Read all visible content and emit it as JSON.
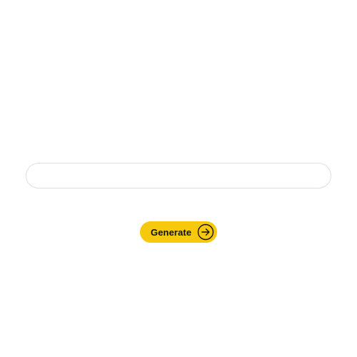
{
  "prompt": {
    "value": "",
    "placeholder": ""
  },
  "generate_button": {
    "label": "Generate",
    "icon": "arrow-right-circle-icon"
  },
  "colors": {
    "accent": "#f7c90c",
    "input_border": "#dedede",
    "text": "#111111"
  }
}
